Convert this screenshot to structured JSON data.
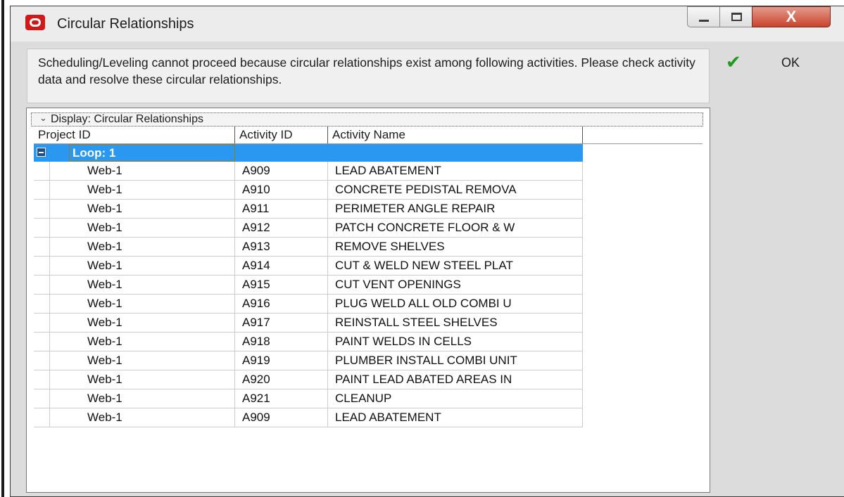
{
  "window": {
    "title": "Circular Relationships",
    "close_glyph": "X"
  },
  "message": "Scheduling/Leveling cannot proceed because circular relationships exist among following activities. Please check activity data and resolve these circular relationships.",
  "ok_button": {
    "label": "OK",
    "icon": "checkmark-icon"
  },
  "display_bar": {
    "label": "Display: Circular Relationships"
  },
  "columns": [
    "Project ID",
    "Activity ID",
    "Activity Name"
  ],
  "loop": {
    "label": "Loop: 1"
  },
  "rows": [
    {
      "project_id": "Web-1",
      "activity_id": "A909",
      "activity_name": "LEAD ABATEMENT"
    },
    {
      "project_id": "Web-1",
      "activity_id": "A910",
      "activity_name": "CONCRETE PEDISTAL REMOVA"
    },
    {
      "project_id": "Web-1",
      "activity_id": "A911",
      "activity_name": "PERIMETER ANGLE REPAIR"
    },
    {
      "project_id": "Web-1",
      "activity_id": "A912",
      "activity_name": "PATCH CONCRETE FLOOR & W"
    },
    {
      "project_id": "Web-1",
      "activity_id": "A913",
      "activity_name": "REMOVE SHELVES"
    },
    {
      "project_id": "Web-1",
      "activity_id": "A914",
      "activity_name": "CUT & WELD NEW STEEL PLAT"
    },
    {
      "project_id": "Web-1",
      "activity_id": "A915",
      "activity_name": "CUT VENT OPENINGS"
    },
    {
      "project_id": "Web-1",
      "activity_id": "A916",
      "activity_name": "PLUG WELD ALL OLD COMBI U"
    },
    {
      "project_id": "Web-1",
      "activity_id": "A917",
      "activity_name": "REINSTALL STEEL SHELVES"
    },
    {
      "project_id": "Web-1",
      "activity_id": "A918",
      "activity_name": "PAINT WELDS IN CELLS"
    },
    {
      "project_id": "Web-1",
      "activity_id": "A919",
      "activity_name": "PLUMBER INSTALL COMBI UNIT"
    },
    {
      "project_id": "Web-1",
      "activity_id": "A920",
      "activity_name": "PAINT LEAD ABATED AREAS IN"
    },
    {
      "project_id": "Web-1",
      "activity_id": "A921",
      "activity_name": "CLEANUP"
    },
    {
      "project_id": "Web-1",
      "activity_id": "A909",
      "activity_name": "LEAD ABATEMENT"
    }
  ],
  "colors": {
    "selection": "#2a98f0",
    "close_button": "#c9432d",
    "app_icon": "#d01919",
    "ok_check": "#1e9a1e"
  }
}
